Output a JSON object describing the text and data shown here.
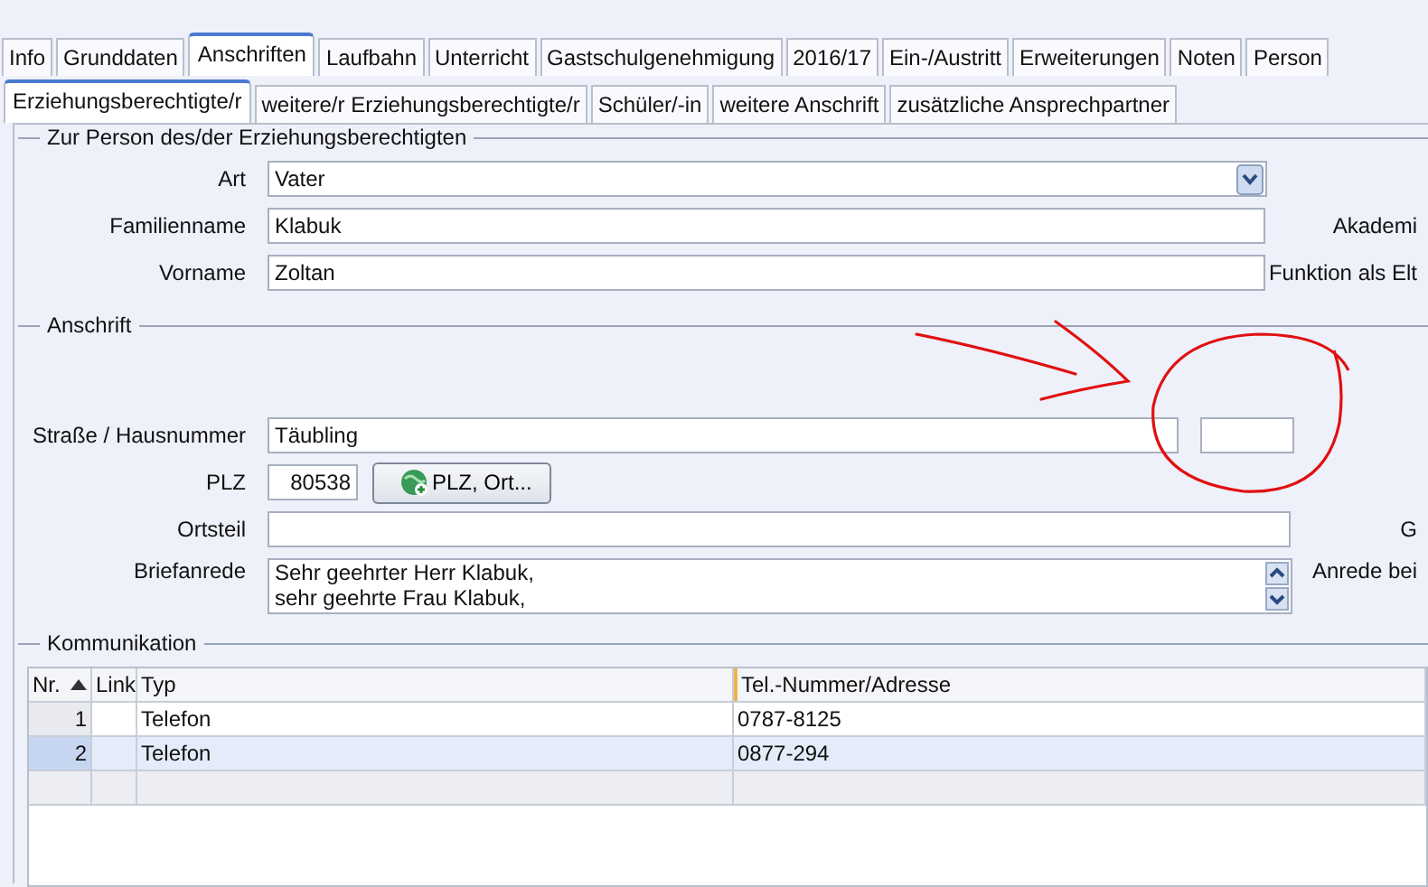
{
  "tabs": [
    {
      "label": "Info",
      "selected": false
    },
    {
      "label": "Grunddaten",
      "selected": false
    },
    {
      "label": "Anschriften",
      "selected": true
    },
    {
      "label": "Laufbahn",
      "selected": false
    },
    {
      "label": "Unterricht",
      "selected": false
    },
    {
      "label": "Gastschulgenehmigung",
      "selected": false
    },
    {
      "label": "2016/17",
      "selected": false
    },
    {
      "label": "Ein-/Austritt",
      "selected": false
    },
    {
      "label": "Erweiterungen",
      "selected": false
    },
    {
      "label": "Noten",
      "selected": false
    },
    {
      "label": "Person",
      "selected": false
    }
  ],
  "subtabs": [
    {
      "label": "Erziehungsberechtigte/r",
      "selected": true
    },
    {
      "label": "weitere/r Erziehungsberechtigte/r",
      "selected": false
    },
    {
      "label": "Schüler/-in",
      "selected": false
    },
    {
      "label": "weitere Anschrift",
      "selected": false
    },
    {
      "label": "zusätzliche Ansprechpartner",
      "selected": false
    }
  ],
  "person_group": {
    "title": "Zur Person des/der Erziehungsberechtigten",
    "fields": [
      {
        "label": "Art",
        "value": "Vater",
        "kind": "dropdown"
      },
      {
        "label": "Familienname",
        "value": "Klabuk",
        "kind": "text",
        "side_label": "Akademi"
      },
      {
        "label": "Vorname",
        "value": "Zoltan",
        "kind": "text",
        "side_label": "Funktion als Elt"
      }
    ]
  },
  "address_group": {
    "title": "Anschrift",
    "street": {
      "label": "Straße / Hausnummer",
      "value": "Täubling"
    },
    "plz": {
      "label": "PLZ",
      "value": "80538",
      "button": "PLZ, Ort..."
    },
    "ortsteil": {
      "label": "Ortsteil",
      "side_label": "G"
    },
    "briefanrede": {
      "label": "Briefanrede",
      "lines": [
        "Sehr geehrter Herr Klabuk,",
        "sehr geehrte Frau Klabuk,"
      ],
      "side_label": "Anrede bei"
    }
  },
  "communication_group": {
    "title": "Kommunikation",
    "table": {
      "columns": [
        "Nr.",
        "Link",
        "Typ",
        "Tel.-Nummer/Adresse"
      ],
      "rows": [
        {
          "nr": "1",
          "type": "Telefon",
          "number": "0787-8125",
          "selected": false
        },
        {
          "nr": "2",
          "type": "Telefon",
          "number": "0877-294",
          "selected": true
        }
      ]
    }
  }
}
